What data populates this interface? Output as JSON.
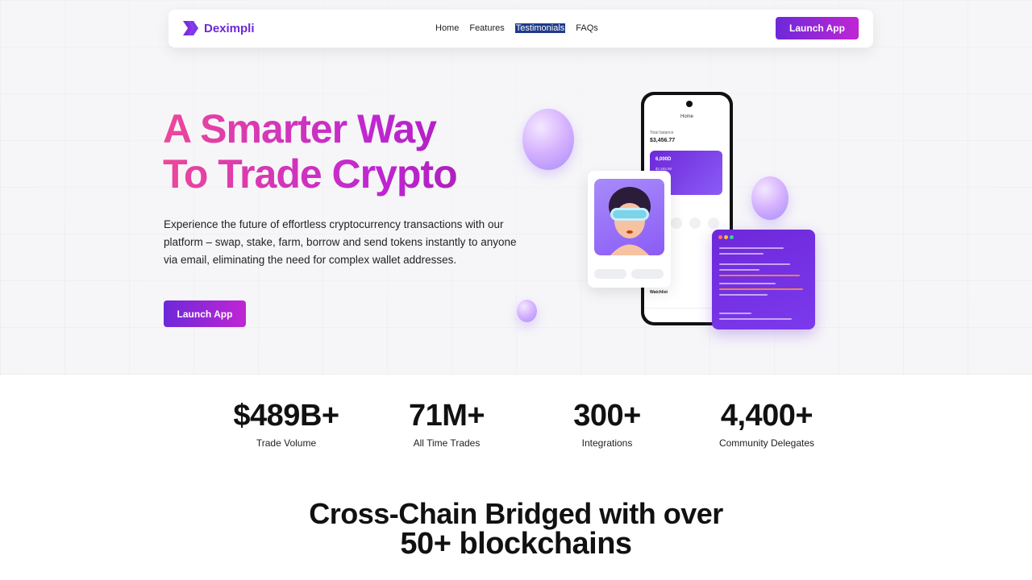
{
  "nav": {
    "brand": "Deximpli",
    "links": [
      {
        "label": "Home"
      },
      {
        "label": "Features"
      },
      {
        "label": "Testimonials"
      },
      {
        "label": "FAQs"
      }
    ],
    "cta_label": "Launch App"
  },
  "hero": {
    "headline_line1": "A Smarter Way",
    "headline_line2": "To Trade Crypto",
    "description": "Experience the future of effortless cryptocurrency transactions with our platform – swap, stake, farm, borrow and send tokens instantly to anyone via email, eliminating the need for complex wallet addresses.",
    "cta_label": "Launch App"
  },
  "phone": {
    "title": "Home",
    "balance_label": "Total balance",
    "balance_value": "$3,456.77",
    "card_value": "6,000D",
    "card_sub": "$1,555.58",
    "watchlist_label": "Watchlist"
  },
  "stats": [
    {
      "value": "$489B+",
      "label": "Trade Volume"
    },
    {
      "value": "71M+",
      "label": "All Time Trades"
    },
    {
      "value": "300+",
      "label": "Integrations"
    },
    {
      "value": "4,400+",
      "label": "Community Delegates"
    }
  ],
  "crosschain": {
    "line1": "Cross-Chain Bridged with over",
    "line2": "50+ blockchains"
  },
  "colors": {
    "brand_purple": "#6d28d9",
    "brand_magenta": "#c026d3",
    "headline_pink": "#ec4899"
  }
}
